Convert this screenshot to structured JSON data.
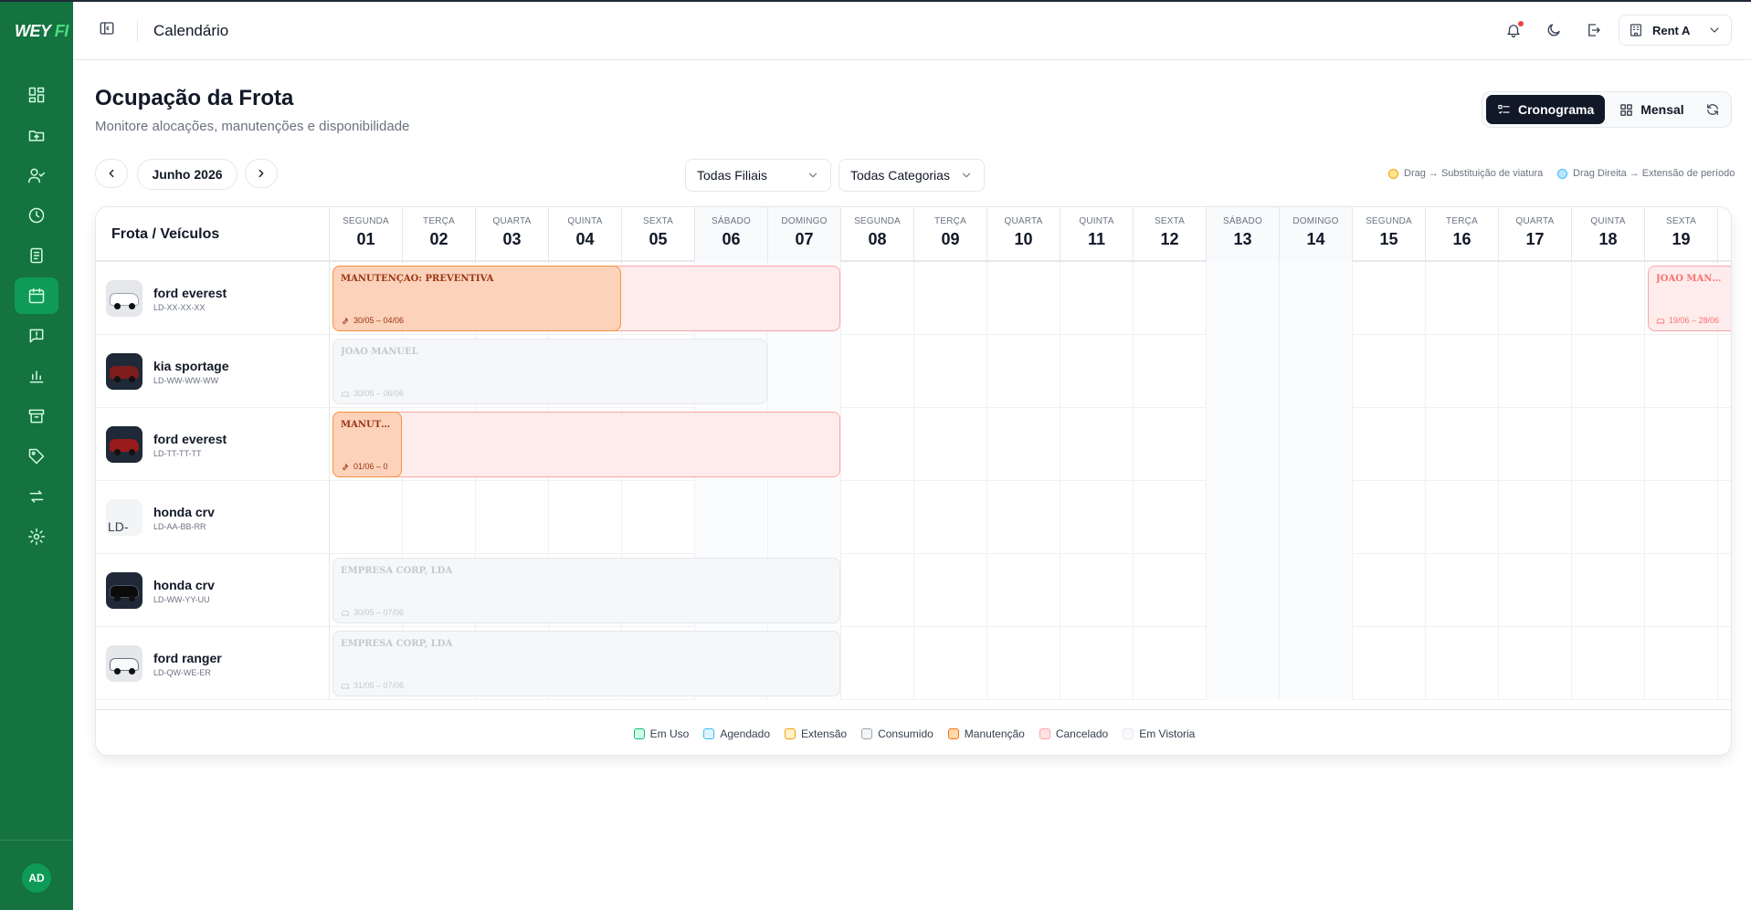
{
  "app": {
    "logo_main": "WEY",
    "logo_accent": "FI"
  },
  "header": {
    "title": "Calendário",
    "company": "Rent A"
  },
  "page": {
    "title": "Ocupação da Frota",
    "subtitle": "Monitore alocações, manutenções e disponibilidade"
  },
  "views": {
    "timeline": "Cronograma",
    "monthly": "Mensal"
  },
  "controls": {
    "month": "Junho 2026",
    "branch_filter": "Todas Filiais",
    "category_filter": "Todas Categorias",
    "hint_drag": "Drag → Substituição de viatura",
    "hint_right_drag": "Drag Direita → Extensão de período"
  },
  "user": {
    "initials": "AD"
  },
  "grid": {
    "fleet_header": "Frota / Veículos",
    "days": [
      {
        "name": "SEGUNDA",
        "num": "01"
      },
      {
        "name": "TERÇA",
        "num": "02"
      },
      {
        "name": "QUARTA",
        "num": "03"
      },
      {
        "name": "QUINTA",
        "num": "04"
      },
      {
        "name": "SEXTA",
        "num": "05"
      },
      {
        "name": "SÁBADO",
        "num": "06"
      },
      {
        "name": "DOMINGO",
        "num": "07"
      },
      {
        "name": "SEGUNDA",
        "num": "08"
      },
      {
        "name": "TERÇA",
        "num": "09"
      },
      {
        "name": "QUARTA",
        "num": "10"
      },
      {
        "name": "QUINTA",
        "num": "11"
      },
      {
        "name": "SEXTA",
        "num": "12"
      },
      {
        "name": "SÁBADO",
        "num": "13"
      },
      {
        "name": "DOMINGO",
        "num": "14"
      },
      {
        "name": "SEGUNDA",
        "num": "15"
      },
      {
        "name": "TERÇA",
        "num": "16"
      },
      {
        "name": "QUARTA",
        "num": "17"
      },
      {
        "name": "QUINTA",
        "num": "18"
      },
      {
        "name": "SEXTA",
        "num": "19"
      }
    ],
    "vehicles": [
      {
        "name": "ford everest",
        "plate": "LD-XX-XX-XX"
      },
      {
        "name": "kia sportage",
        "plate": "LD-WW-WW-WW"
      },
      {
        "name": "ford everest",
        "plate": "LD-TT-TT-TT"
      },
      {
        "name": "honda crv",
        "plate": "LD-AA-BB-RR",
        "img_alt": "LD-"
      },
      {
        "name": "honda crv",
        "plate": "LD-WW-YY-UU"
      },
      {
        "name": "ford ranger",
        "plate": "LD-QW-WE-ER"
      }
    ],
    "bookings": {
      "r0_cancel": {
        "title": "",
        "dates": ""
      },
      "r0_maint": {
        "title": "MANUTENÇÃO: PREVENTIVA",
        "dates": "30/05 – 04/06"
      },
      "r0_right": {
        "title": "JOAO MANUEL",
        "dates": "19/06 – 28/06"
      },
      "r1_used": {
        "title": "JOAO MANUEL",
        "dates": "30/05 – 06/06"
      },
      "r2_cancel": {
        "title": "",
        "dates": ""
      },
      "r2_maint": {
        "title": "MANUTE...LDA",
        "dates": "01/06 – 0"
      },
      "r4_used": {
        "title": "EMPRESA CORP, LDA",
        "dates": "30/05 – 07/06"
      },
      "r5_used": {
        "title": "EMPRESA CORP, LDA",
        "dates": "31/05 – 07/06"
      }
    }
  },
  "legend": [
    {
      "label": "Em Uso",
      "bg": "#d1fae5",
      "border": "#10b981"
    },
    {
      "label": "Agendado",
      "bg": "#e0f2fe",
      "border": "#38bdf8"
    },
    {
      "label": "Extensão",
      "bg": "#fef3c7",
      "border": "#f59e0b"
    },
    {
      "label": "Consumido",
      "bg": "#f3f4f6",
      "border": "#9ca3af"
    },
    {
      "label": "Manutenção",
      "bg": "#fed7aa",
      "border": "#f97316"
    },
    {
      "label": "Cancelado",
      "bg": "#fee2e2",
      "border": "#fca5a5"
    },
    {
      "label": "Em Vistoria",
      "bg": "#f9fafb",
      "border": "#e5e7eb"
    }
  ],
  "colors": {
    "sidebar": "#14733f",
    "sidebar_active": "#0f9b57",
    "primary_dark": "#111827"
  }
}
